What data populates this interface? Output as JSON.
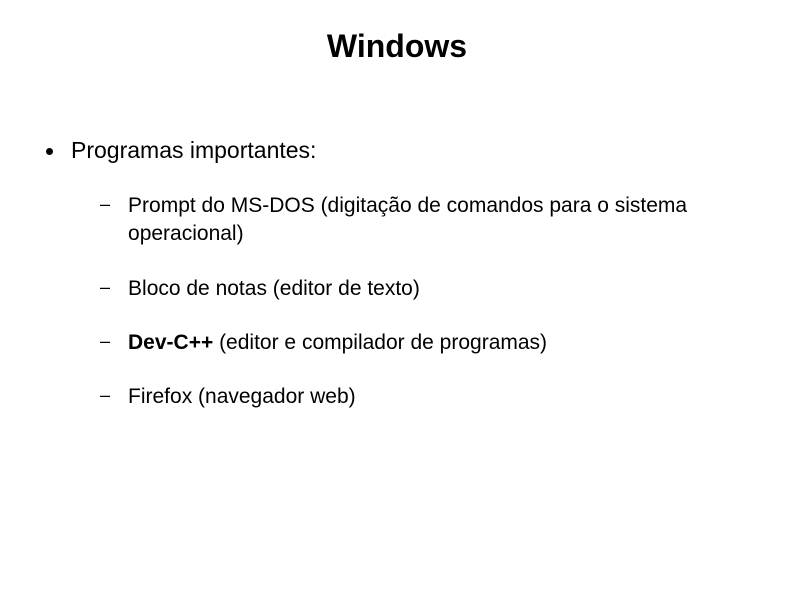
{
  "title": "Windows",
  "main_item": "Programas importantes:",
  "sub_items": [
    {
      "text": "Prompt do MS-DOS (digitação de comandos para o sistema operacional)"
    },
    {
      "text": "Bloco de notas (editor de texto)"
    },
    {
      "bold_prefix": "Dev-C++",
      "rest": " (editor e compilador de programas)"
    },
    {
      "text": "Firefox (navegador web)"
    }
  ]
}
